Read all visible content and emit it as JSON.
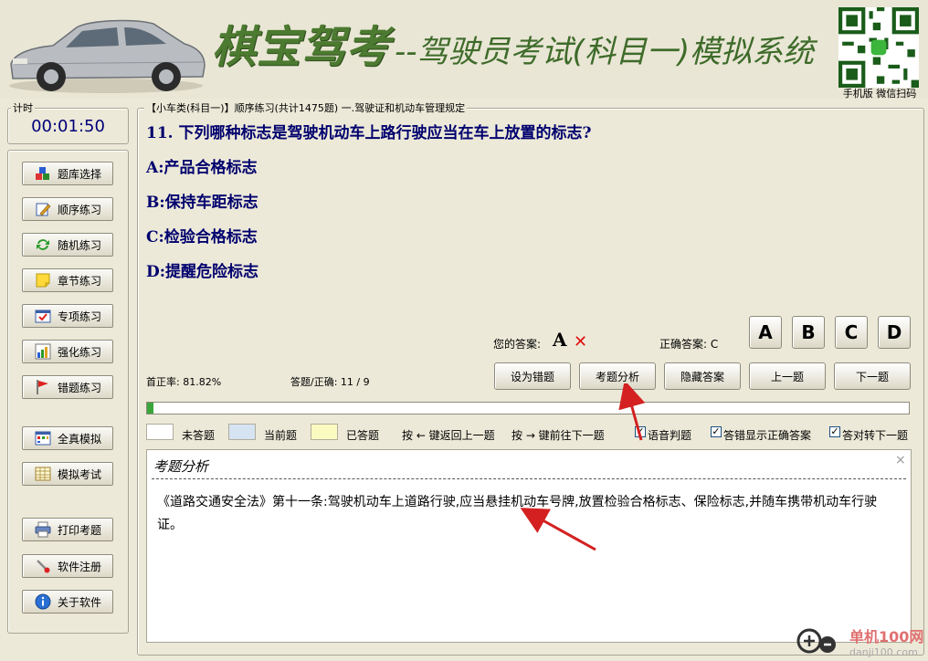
{
  "header": {
    "brand": "棋宝驾考",
    "subtitle": "--驾驶员考试(科目一)模拟系统",
    "qr_caption": "手机版 微信扫码"
  },
  "timer": {
    "legend": "计时",
    "value": "00:01:50"
  },
  "nav": [
    {
      "label": "题库选择",
      "icon": "cubes-icon"
    },
    {
      "label": "顺序练习",
      "icon": "pencil-icon"
    },
    {
      "label": "随机练习",
      "icon": "refresh-icon"
    },
    {
      "label": "章节练习",
      "icon": "note-icon"
    },
    {
      "label": "专项练习",
      "icon": "calendar-check-icon"
    },
    {
      "label": "强化练习",
      "icon": "bar-chart-icon"
    },
    {
      "label": "错题练习",
      "icon": "flag-icon"
    },
    {
      "label": "全真模拟",
      "icon": "grid-icon"
    },
    {
      "label": "模拟考试",
      "icon": "table-icon"
    },
    {
      "label": "打印考题",
      "icon": "printer-icon"
    },
    {
      "label": "软件注册",
      "icon": "key-icon"
    },
    {
      "label": "关于软件",
      "icon": "info-icon"
    }
  ],
  "breadcrumb": "【小车类(科目一)】顺序练习(共计1475题) 一.驾驶证和机动车管理规定",
  "question": {
    "text": "11. 下列哪种标志是驾驶机动车上路行驶应当在车上放置的标志?",
    "options": [
      "A:产品合格标志",
      "B:保持车距标志",
      "C:检验合格标志",
      "D:提醒危险标志"
    ]
  },
  "answer": {
    "your_label": "您的答案:",
    "your_value": "A",
    "wrong_mark": "✕",
    "correct_label": "正确答案: C",
    "buttons": [
      "A",
      "B",
      "C",
      "D"
    ]
  },
  "stats": {
    "accuracy": "首正率: 81.82%",
    "answered": "答题/正确: 11 / 9",
    "progress": 0.008
  },
  "actions": [
    "设为错题",
    "考题分析",
    "隐藏答案",
    "上一题",
    "下一题"
  ],
  "legend": {
    "unanswered": "未答题",
    "current": "当前题",
    "answered": "已答题",
    "key_prev": "按 ← 键返回上一题",
    "key_next": "按 → 键前往下一题",
    "colors": {
      "unanswered": "#ffffff",
      "current": "#d6e3f3",
      "answered": "#fbfbc1"
    }
  },
  "options": [
    {
      "label": "语音判题",
      "checked": true
    },
    {
      "label": "答错显示正确答案",
      "checked": true
    },
    {
      "label": "答对转下一题",
      "checked": true
    }
  ],
  "analysis": {
    "title": "考题分析",
    "close": "×",
    "text": "《道路交通安全法》第十一条:驾驶机动车上道路行驶,应当悬挂机动车号牌,放置检验合格标志、保险标志,并随车携带机动车行驶证。"
  },
  "watermark": {
    "cn": "单机100网",
    "url": "danji100.com"
  }
}
